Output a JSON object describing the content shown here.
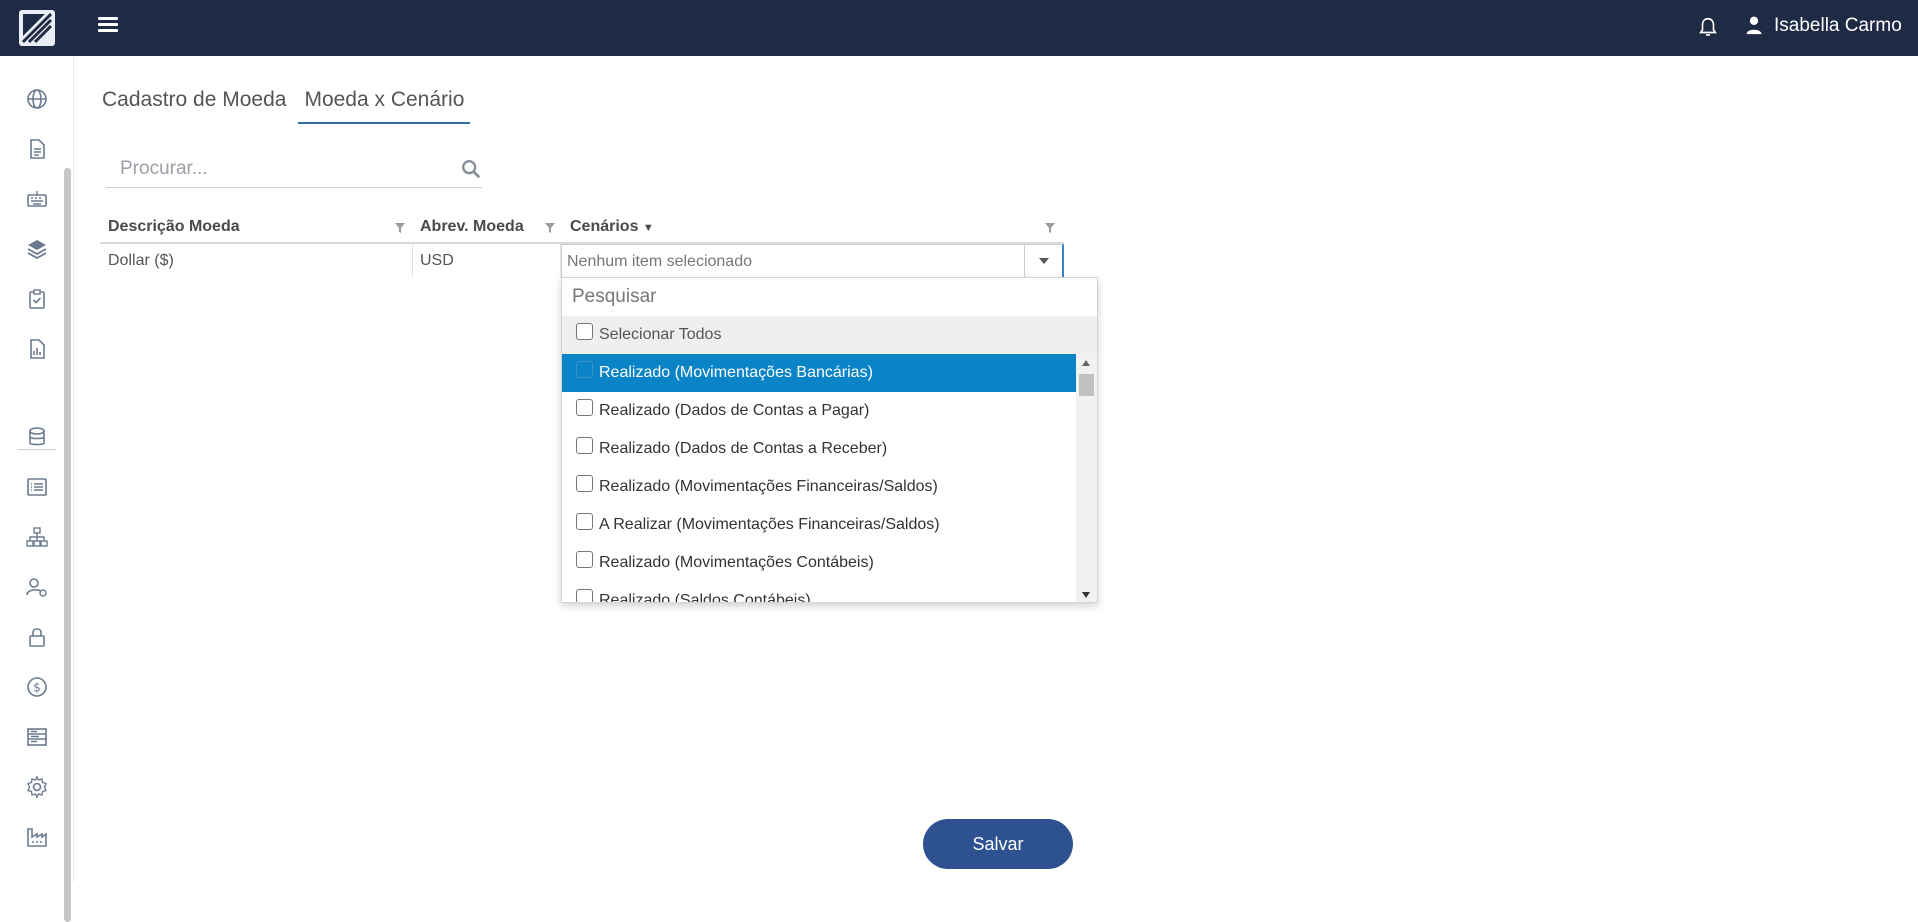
{
  "header": {
    "user_name": "Isabella Carmo"
  },
  "tabs": [
    {
      "label": "Cadastro de Moeda",
      "active": false
    },
    {
      "label": "Moeda x Cenário",
      "active": true
    }
  ],
  "search": {
    "placeholder": "Procurar..."
  },
  "grid": {
    "columns": [
      {
        "label": "Descrição Moeda"
      },
      {
        "label": "Abrev. Moeda"
      },
      {
        "label": "Cenários"
      }
    ],
    "rows": [
      {
        "description": "Dollar ($)",
        "abbrev": "USD",
        "scenarios": "Nenhum item selecionado"
      }
    ]
  },
  "dropdown": {
    "search_placeholder": "Pesquisar",
    "select_all_label": "Selecionar Todos",
    "items": [
      {
        "label": "Realizado (Movimentações Bancárias)",
        "highlighted": true,
        "checked": false
      },
      {
        "label": "Realizado (Dados de Contas a Pagar)",
        "highlighted": false,
        "checked": false
      },
      {
        "label": "Realizado (Dados de Contas a Receber)",
        "highlighted": false,
        "checked": false
      },
      {
        "label": "Realizado (Movimentações Financeiras/Saldos)",
        "highlighted": false,
        "checked": false
      },
      {
        "label": "A Realizar (Movimentações Financeiras/Saldos)",
        "highlighted": false,
        "checked": false
      },
      {
        "label": "Realizado (Movimentações Contábeis)",
        "highlighted": false,
        "checked": false
      },
      {
        "label": "Realizado (Saldos Contábeis)",
        "highlighted": false,
        "checked": false
      }
    ]
  },
  "actions": {
    "save_label": "Salvar"
  },
  "colors": {
    "topbar": "#1f2a44",
    "accent": "#2d5191",
    "highlight": "#0a84c6"
  },
  "sidebar": {
    "icons": [
      "globe-icon",
      "document-icon",
      "keyboard-icon",
      "layers-icon",
      "clipboard-check-icon",
      "report-icon",
      "database-icon",
      "list-icon",
      "org-chart-icon",
      "user-settings-icon",
      "lock-icon",
      "currency-icon",
      "panel-list-icon",
      "gear-icon",
      "factory-icon"
    ]
  }
}
